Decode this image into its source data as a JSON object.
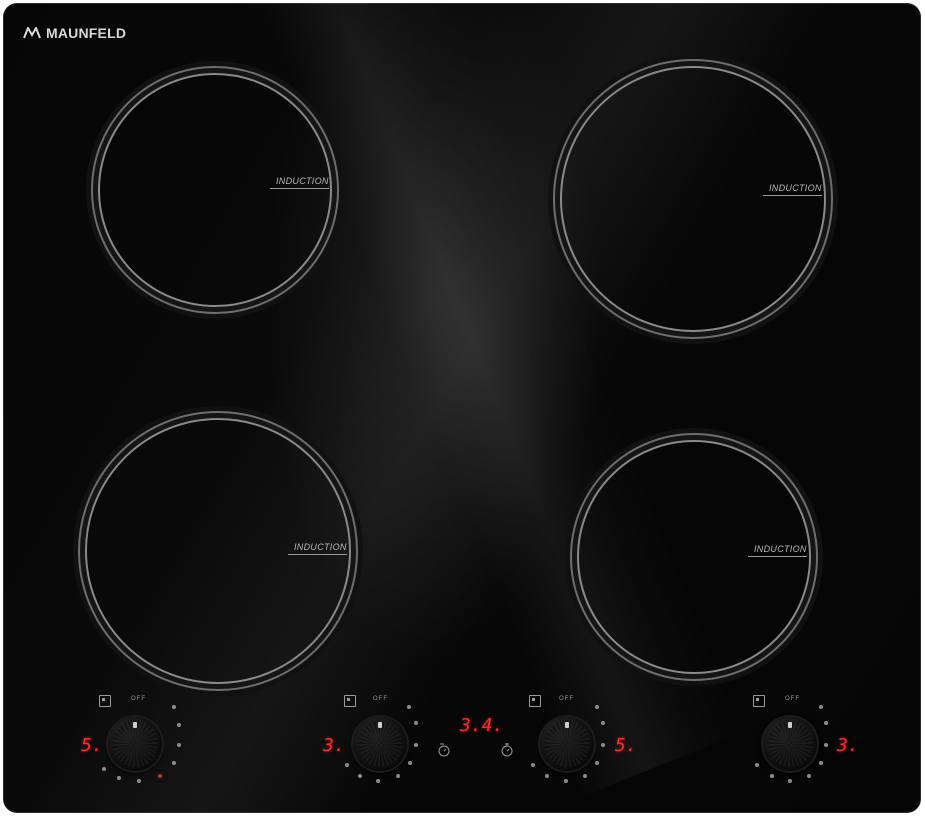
{
  "brand": {
    "name": "MAUNFELD",
    "logo_icon": "maunfeld-logo-mark"
  },
  "zones": [
    {
      "id": "rear-left",
      "label": "INDUCTION"
    },
    {
      "id": "rear-right",
      "label": "INDUCTION"
    },
    {
      "id": "front-left",
      "label": "INDUCTION"
    },
    {
      "id": "front-right",
      "label": "INDUCTION"
    }
  ],
  "controls": [
    {
      "id": "front-left",
      "off_label": "OFF",
      "display": "5.",
      "icon": "zone-position-icon"
    },
    {
      "id": "rear-left",
      "off_label": "OFF",
      "display": "3.",
      "icon": "zone-position-icon"
    },
    {
      "id": "rear-right",
      "off_label": "OFF",
      "display": "5.",
      "icon": "zone-position-icon"
    },
    {
      "id": "front-right",
      "off_label": "OFF",
      "display": "3.",
      "icon": "zone-position-icon"
    }
  ],
  "timer": {
    "display": "3.4.",
    "minus_icon": "timer-minus-icon",
    "plus_icon": "timer-plus-icon"
  },
  "colors": {
    "glass": "#050505",
    "ring": "#8a8a8a",
    "display": "#ff2a2a"
  }
}
